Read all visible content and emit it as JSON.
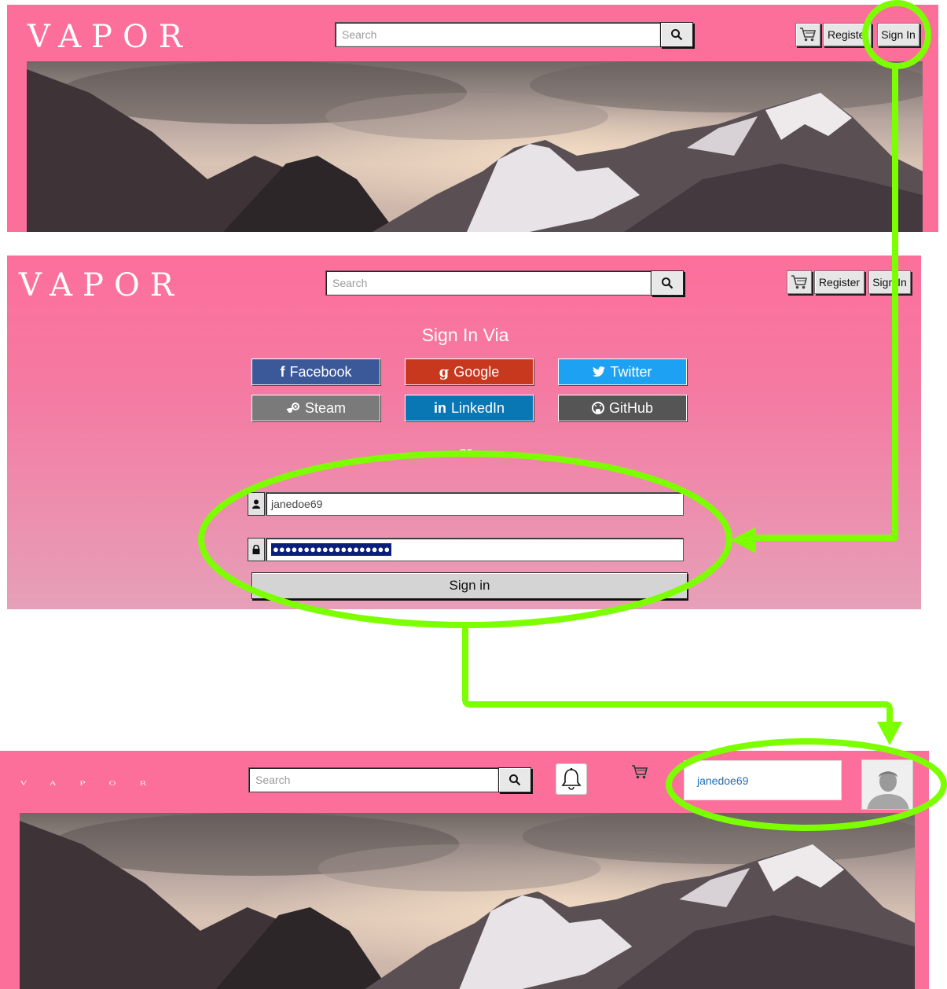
{
  "brand": {
    "logo": "VAPOR"
  },
  "header_before": {
    "search_placeholder": "Search",
    "register_label": "Register",
    "sign_in_label": "Sign In",
    "icons": [
      "search-icon",
      "cart-icon"
    ]
  },
  "sign_in_panel": {
    "header": {
      "search_placeholder": "Search",
      "register_label": "Register",
      "sign_in_label": "Sign In"
    },
    "heading": "Sign In Via",
    "providers": [
      {
        "label": "Facebook",
        "icon": "facebook-icon",
        "color": "#3b5998"
      },
      {
        "label": "Google",
        "icon": "google-icon",
        "color": "#c8381f"
      },
      {
        "label": "Twitter",
        "icon": "twitter-icon",
        "color": "#1da1f2"
      },
      {
        "label": "Steam",
        "icon": "steam-icon",
        "color": "#7a7a7a"
      },
      {
        "label": "LinkedIn",
        "icon": "linkedin-icon",
        "color": "#0a77b5"
      },
      {
        "label": "GitHub",
        "icon": "github-icon",
        "color": "#555555"
      }
    ],
    "separator": "or",
    "username_value": "janedoe69",
    "password_masked": "●●●●●●●●●●●●●●●●●●●",
    "submit_label": "Sign in"
  },
  "header_after": {
    "search_placeholder": "Search",
    "username": "janedoe69",
    "icons": [
      "search-icon",
      "bell-icon",
      "cart-icon",
      "avatar-icon"
    ]
  },
  "colors": {
    "brand_pink": "#fb709e",
    "highlight_green": "#7cff00"
  }
}
